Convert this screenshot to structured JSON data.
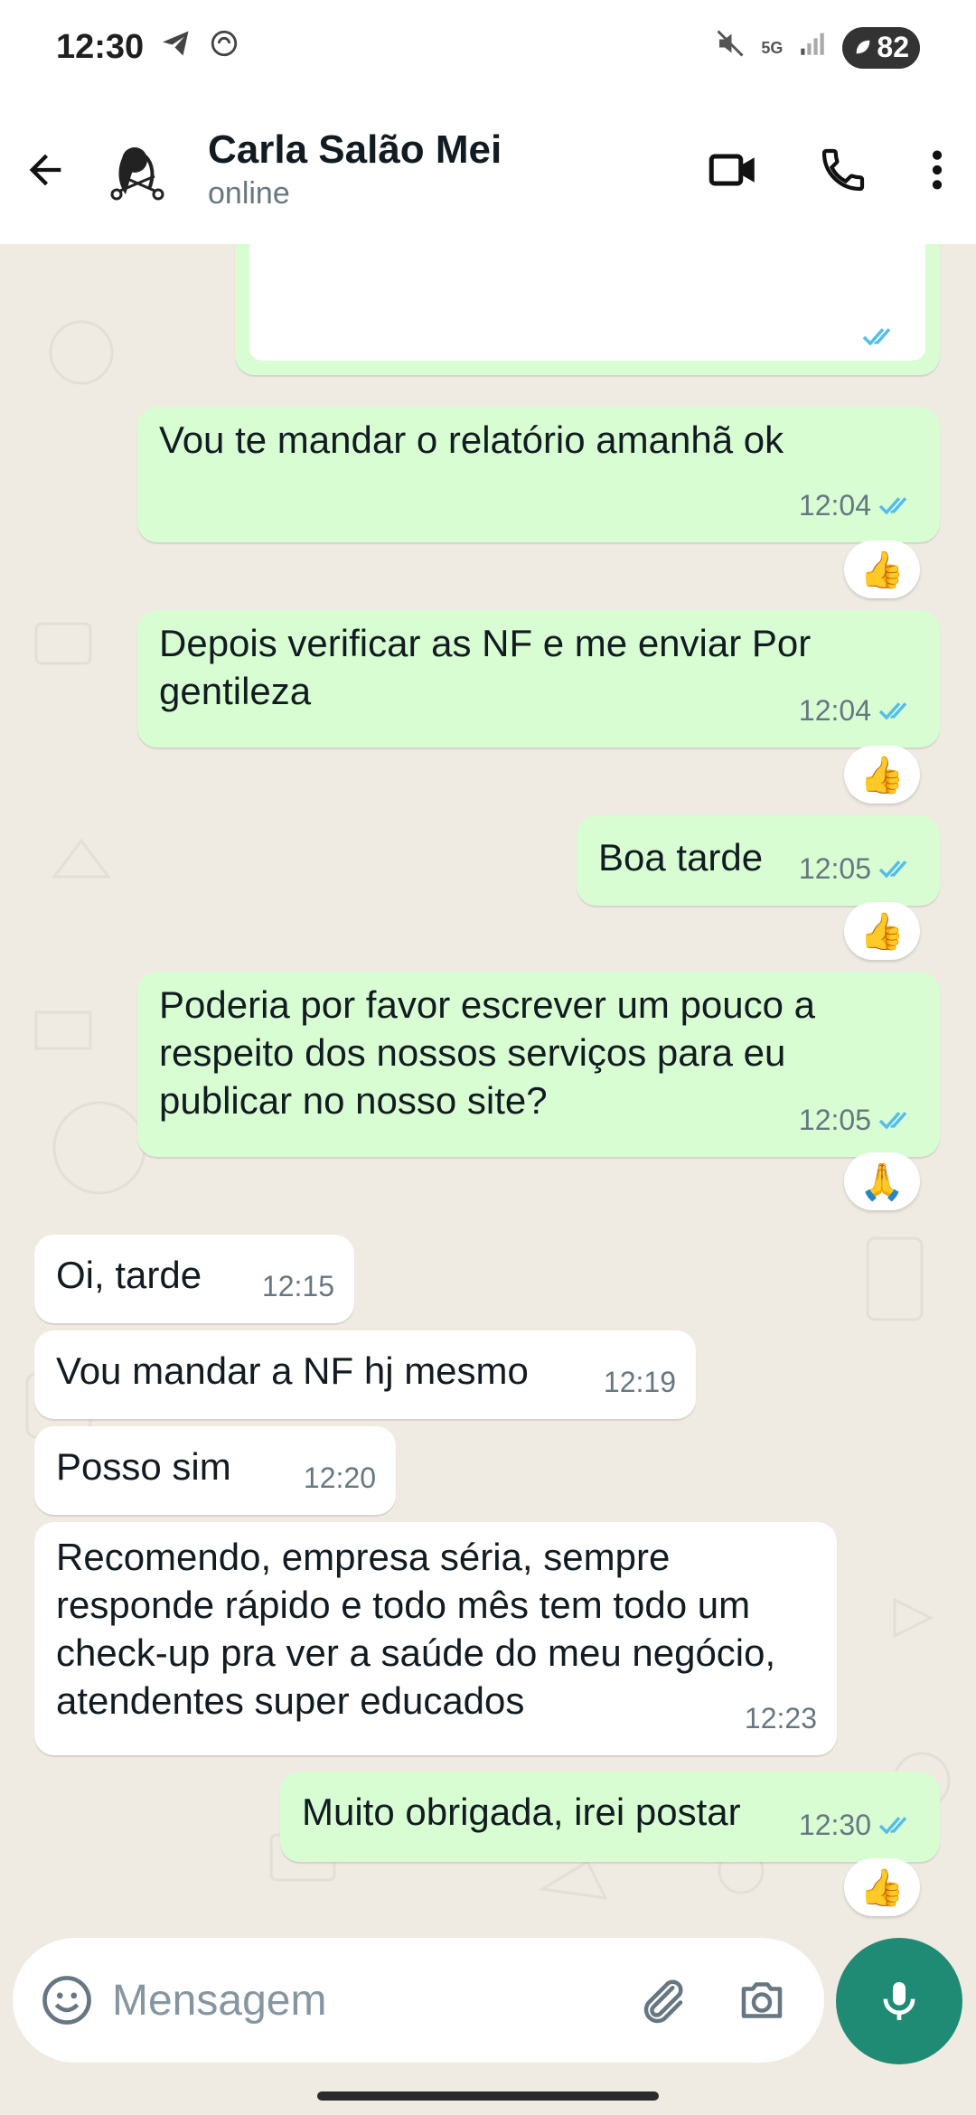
{
  "status_bar": {
    "time": "12:30",
    "network": "5G",
    "battery": "82"
  },
  "header": {
    "contact_name": "Carla Salão Mei",
    "contact_status": "online"
  },
  "colors": {
    "outgoing_bubble": "#d9fdd3",
    "incoming_bubble": "#ffffff",
    "read_ticks": "#53bdeb",
    "accent": "#1f8b74",
    "chat_background": "#efeae2"
  },
  "messages": [
    {
      "id": "m1",
      "direction": "out",
      "text": "Vou te mandar o relatório amanhã ok",
      "time": "12:04",
      "reaction": "👍",
      "read": true
    },
    {
      "id": "m2",
      "direction": "out",
      "text": "Depois verificar as NF e me enviar Por gentileza",
      "time": "12:04",
      "reaction": "👍",
      "read": true
    },
    {
      "id": "m3",
      "direction": "out",
      "text": "Boa tarde",
      "time": "12:05",
      "reaction": "👍",
      "read": true
    },
    {
      "id": "m4",
      "direction": "out",
      "text": "Poderia por favor escrever um pouco a respeito dos nossos serviços para eu publicar no nosso site?",
      "time": "12:05",
      "reaction": "🙏",
      "read": true
    },
    {
      "id": "m5",
      "direction": "in",
      "text": "Oi, tarde",
      "time": "12:15"
    },
    {
      "id": "m6",
      "direction": "in",
      "text": "Vou mandar a NF hj mesmo",
      "time": "12:19"
    },
    {
      "id": "m7",
      "direction": "in",
      "text": "Posso sim",
      "time": "12:20"
    },
    {
      "id": "m8",
      "direction": "in",
      "text": "Recomendo, empresa séria, sempre responde rápido e todo mês tem todo um check-up pra ver a saúde do meu negócio, atendentes super educados",
      "time": "12:23"
    },
    {
      "id": "m9",
      "direction": "out",
      "text": "Muito obrigada, irei postar",
      "time": "12:30",
      "reaction": "👍",
      "read": true
    }
  ],
  "composer": {
    "placeholder": "Mensagem"
  }
}
